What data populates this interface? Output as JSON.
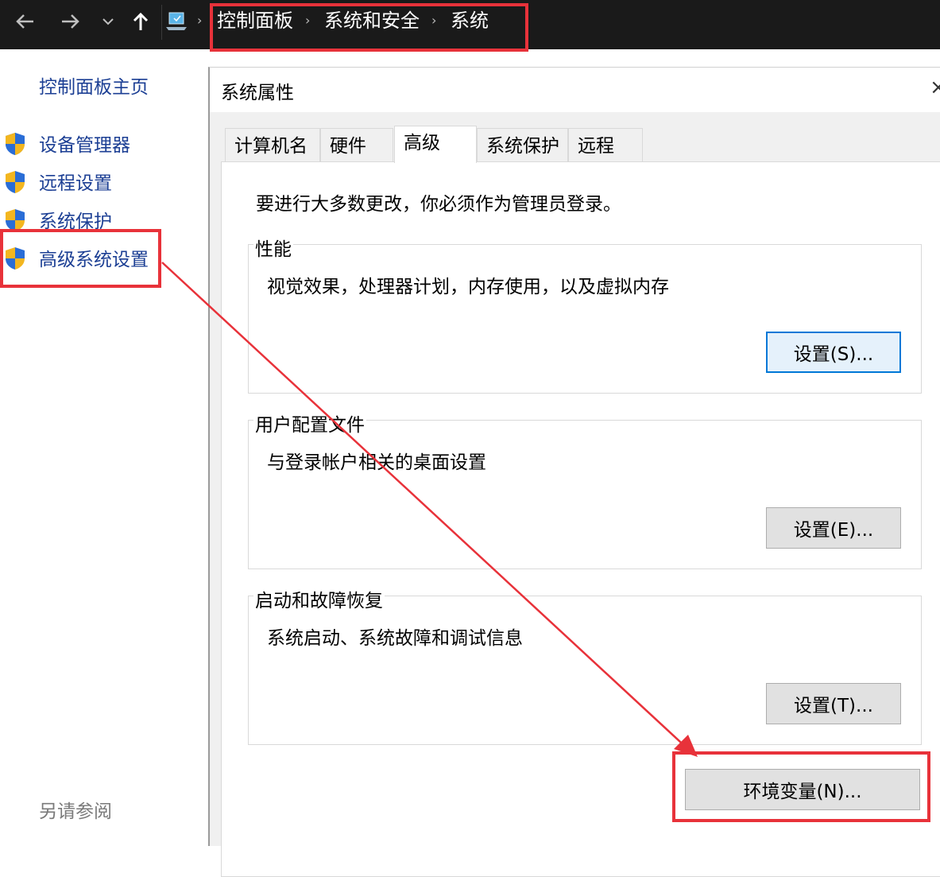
{
  "address_bar": {
    "back_icon": "arrow-left-icon",
    "forward_icon": "arrow-right-icon",
    "recent_icon": "chevron-down-icon",
    "up_icon": "arrow-up-icon",
    "location_icon": "computer-icon",
    "breadcrumbs": [
      "控制面板",
      "系统和安全",
      "系统"
    ]
  },
  "left_pane": {
    "home": "控制面板主页",
    "items": [
      {
        "label": "设备管理器",
        "icon": "uac-shield-icon"
      },
      {
        "label": "远程设置",
        "icon": "uac-shield-icon"
      },
      {
        "label": "系统保护",
        "icon": "uac-shield-icon"
      },
      {
        "label": "高级系统设置",
        "icon": "uac-shield-icon"
      }
    ],
    "see_also": "另请参阅"
  },
  "dialog": {
    "title": "系统属性",
    "close_glyph": "×",
    "tabs": [
      {
        "label": "计算机名",
        "active": false
      },
      {
        "label": "硬件",
        "active": false
      },
      {
        "label": "高级",
        "active": true
      },
      {
        "label": "系统保护",
        "active": false
      },
      {
        "label": "远程",
        "active": false
      }
    ],
    "notice": "要进行大多数更改，你必须作为管理员登录。",
    "groups": [
      {
        "title": "性能",
        "description": "视觉效果，处理器计划，内存使用，以及虚拟内存",
        "button": "设置(S)..."
      },
      {
        "title": "用户配置文件",
        "description": "与登录帐户相关的桌面设置",
        "button": "设置(E)..."
      },
      {
        "title": "启动和故障恢复",
        "description": "系统启动、系统故障和调试信息",
        "button": "设置(T)..."
      }
    ],
    "env_button": "环境变量(N)..."
  },
  "annotation_colors": {
    "highlight": "#e8323a",
    "link": "#1c3f94"
  }
}
